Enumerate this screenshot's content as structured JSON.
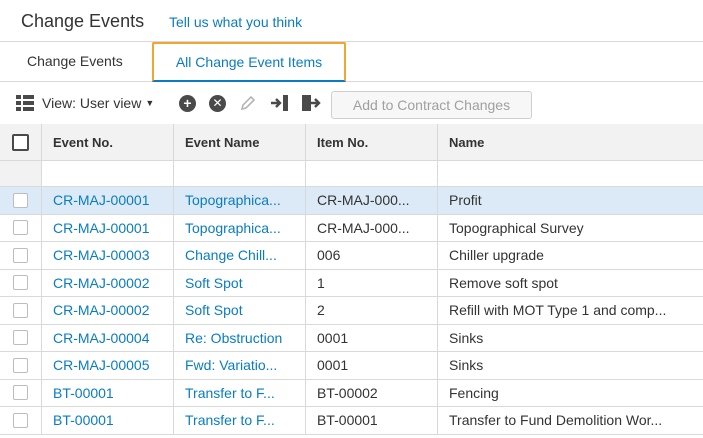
{
  "header": {
    "title": "Change Events",
    "feedback_link": "Tell us what you think"
  },
  "tabs": [
    {
      "label": "Change Events",
      "active": false
    },
    {
      "label": "All Change Event Items",
      "active": true
    }
  ],
  "toolbar": {
    "view_label": "View: User view",
    "icons": [
      "grid-icon",
      "add-icon",
      "remove-icon",
      "edit-icon",
      "import-icon",
      "export-icon"
    ],
    "add_to_contract_label": "Add to Contract Changes"
  },
  "table": {
    "columns": [
      "Event No.",
      "Event Name",
      "Item No.",
      "Name"
    ],
    "rows": [
      {
        "event_no": "CR-MAJ-00001",
        "event_name": "Topographica...",
        "item_no": "CR-MAJ-000...",
        "name": "Profit",
        "selected": true
      },
      {
        "event_no": "CR-MAJ-00001",
        "event_name": "Topographica...",
        "item_no": "CR-MAJ-000...",
        "name": "Topographical Survey"
      },
      {
        "event_no": "CR-MAJ-00003",
        "event_name": "Change Chill...",
        "item_no": "006",
        "name": "Chiller upgrade"
      },
      {
        "event_no": "CR-MAJ-00002",
        "event_name": "Soft Spot",
        "item_no": "1",
        "name": "Remove soft spot"
      },
      {
        "event_no": "CR-MAJ-00002",
        "event_name": "Soft Spot",
        "item_no": "2",
        "name": "Refill with MOT Type 1 and comp..."
      },
      {
        "event_no": "CR-MAJ-00004",
        "event_name": "Re: Obstruction",
        "item_no": "0001",
        "name": "Sinks"
      },
      {
        "event_no": "CR-MAJ-00005",
        "event_name": "Fwd: Variatio...",
        "item_no": "0001",
        "name": "Sinks"
      },
      {
        "event_no": "BT-00001",
        "event_name": "Transfer to F...",
        "item_no": "BT-00002",
        "name": "Fencing"
      },
      {
        "event_no": "BT-00001",
        "event_name": "Transfer to F...",
        "item_no": "BT-00001",
        "name": "Transfer to Fund Demolition Wor..."
      }
    ]
  },
  "colors": {
    "link": "#0a7cc1",
    "tab_highlight": "#f0a732",
    "selected_row": "#dbeaf6"
  }
}
